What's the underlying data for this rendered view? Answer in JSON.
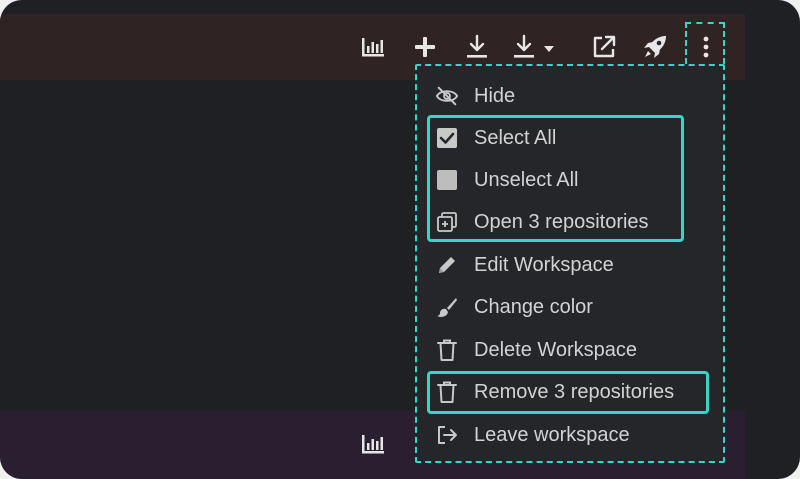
{
  "toolbar": {
    "icons": [
      "bar-chart-icon",
      "plus-icon",
      "download-icon",
      "download-dropdown-icon",
      "external-link-icon",
      "rocket-icon",
      "more-vertical-icon"
    ]
  },
  "bottom_bar": {
    "icons": [
      "bar-chart-icon"
    ]
  },
  "menu": {
    "items": [
      {
        "label": "Hide",
        "icon": "eye-off-icon"
      },
      {
        "label": "Select All",
        "icon": "checkbox-checked-icon"
      },
      {
        "label": "Unselect All",
        "icon": "checkbox-empty-icon"
      },
      {
        "label": "Open 3 repositories",
        "icon": "open-multiple-icon"
      },
      {
        "label": "Edit Workspace",
        "icon": "pencil-icon"
      },
      {
        "label": "Change color",
        "icon": "paintbrush-icon"
      },
      {
        "label": "Delete Workspace",
        "icon": "trash-icon"
      },
      {
        "label": "Remove 3 repositories",
        "icon": "trash-icon"
      },
      {
        "label": "Leave workspace",
        "icon": "leave-icon"
      }
    ]
  },
  "colors": {
    "highlight": "#33d6c8",
    "top_bar": "#2f2323",
    "bottom_bar": "#2a1f30",
    "background": "#1e2023",
    "menu_bg": "#24262a",
    "text": "#d3d3d3"
  }
}
